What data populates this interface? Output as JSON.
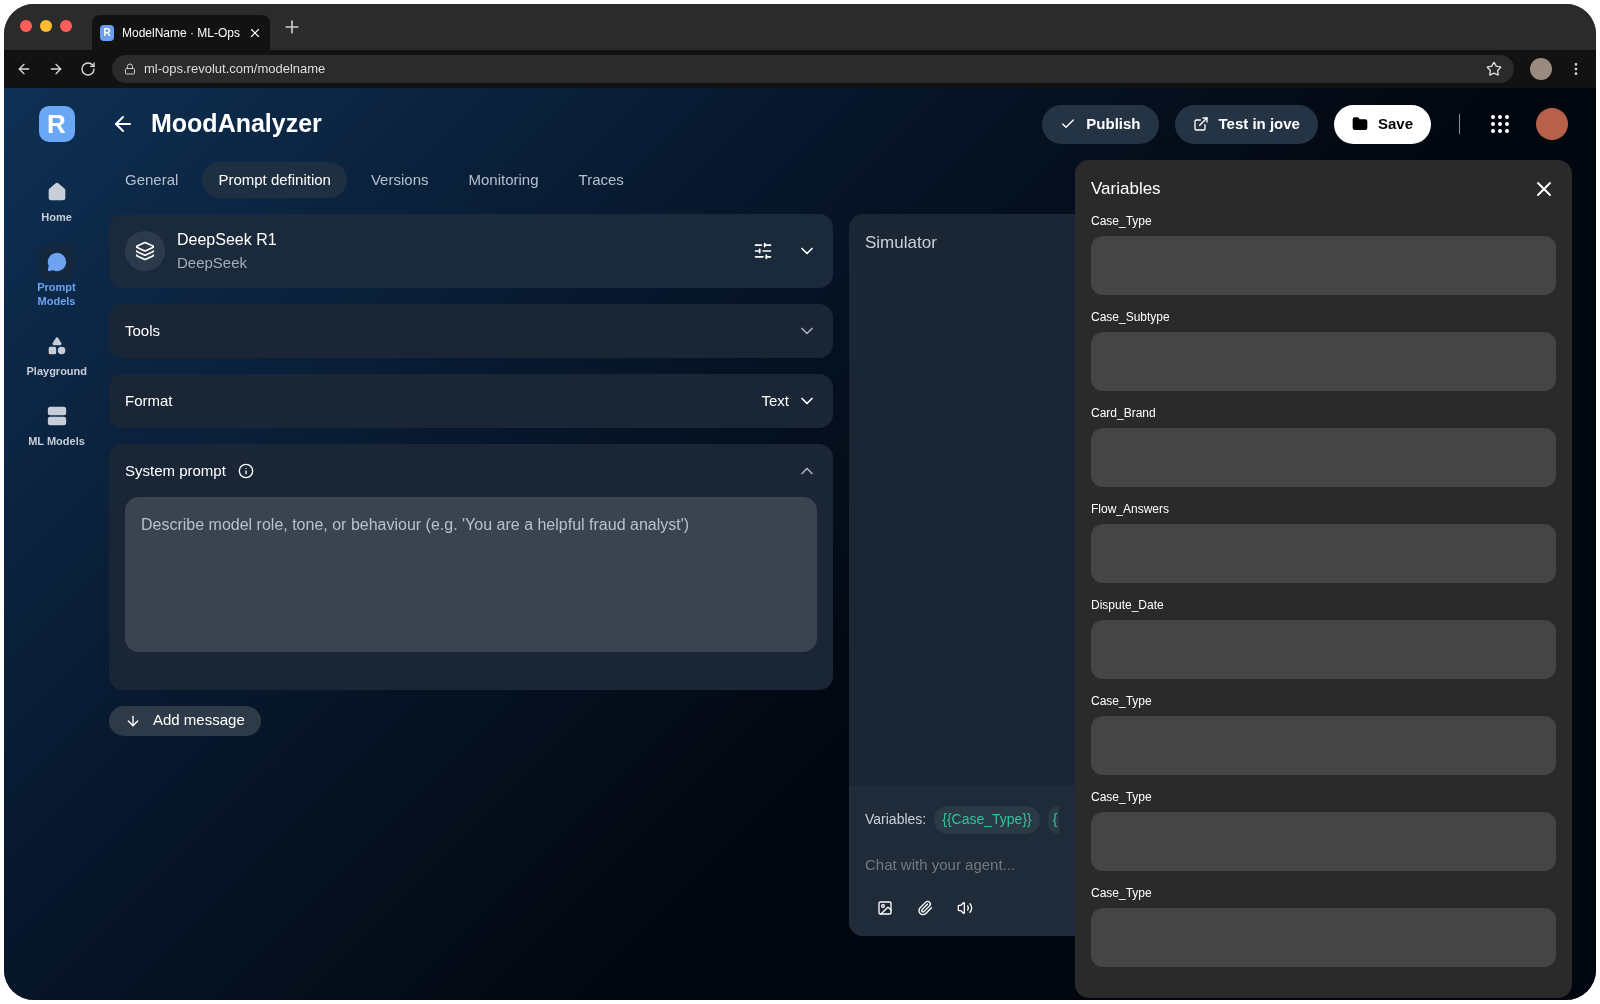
{
  "browser": {
    "favicon": "R",
    "tab_title": "ModelName · ML-Ops",
    "url": "ml-ops.revolut.com/modelname"
  },
  "sidebar": {
    "logo": "R",
    "items": [
      {
        "label": "Home",
        "selected": false
      },
      {
        "label": "Prompt Models",
        "selected": true
      },
      {
        "label": "Playground",
        "selected": false
      },
      {
        "label": "ML Models",
        "selected": false
      }
    ]
  },
  "header": {
    "title": "MoodAnalyzer",
    "buttons": [
      {
        "label": "Publish",
        "kind": "publish"
      },
      {
        "label": "Test in jove",
        "kind": "external"
      },
      {
        "label": "Save",
        "kind": "save"
      }
    ]
  },
  "tabs": [
    {
      "label": "General",
      "selected": false
    },
    {
      "label": "Prompt definition",
      "selected": true
    },
    {
      "label": "Versions",
      "selected": false
    },
    {
      "label": "Monitoring",
      "selected": false
    },
    {
      "label": "Traces",
      "selected": false
    }
  ],
  "model": {
    "name": "DeepSeek R1",
    "provider": "DeepSeek"
  },
  "tools": {
    "label": "Tools",
    "expanded": false
  },
  "format": {
    "label": "Format",
    "value": "Text"
  },
  "system_prompt": {
    "label": "System prompt",
    "expanded": true,
    "placeholder": "Describe model role, tone, or behaviour (e.g. 'You are a helpful fraud analyst')"
  },
  "add_message": "Add message",
  "simulator": {
    "title": "Simulator",
    "variables_label": "Variables:",
    "chips": [
      "{{Case_Type}}",
      "{"
    ],
    "chat_placeholder": "Chat with your agent..."
  },
  "variables_panel": {
    "title": "Variables",
    "fields": [
      {
        "label": "Case_Type"
      },
      {
        "label": "Case_Subtype"
      },
      {
        "label": "Card_Brand"
      },
      {
        "label": "Flow_Answers"
      },
      {
        "label": "Dispute_Date"
      },
      {
        "label": "Case_Type"
      },
      {
        "label": "Case_Type"
      },
      {
        "label": "Case_Type"
      }
    ]
  }
}
